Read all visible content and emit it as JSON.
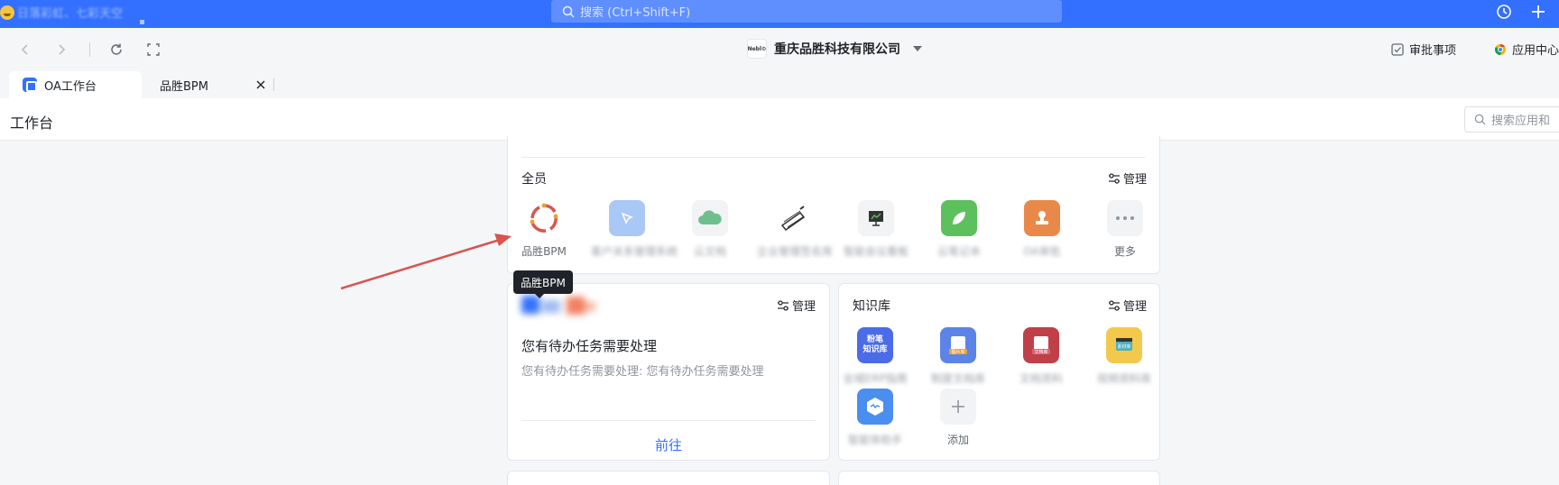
{
  "topbar": {
    "user_status": "日落彩虹、七彩天空",
    "search_placeholder": "搜索 (Ctrl+Shift+F)"
  },
  "navbar": {
    "company_name": "重庆品胜科技有限公司",
    "company_logo_text": "Nebl⚙",
    "approvals": "审批事项",
    "app_center": "应用中心"
  },
  "tabs": [
    {
      "label": "OA工作台"
    },
    {
      "label": "品胜BPM"
    }
  ],
  "header": {
    "title": "工作台",
    "search_placeholder": "搜索应用和"
  },
  "quanyuan": {
    "title": "全员",
    "manage": "管理",
    "apps": [
      {
        "label": "品胜BPM",
        "icon": "bpm-icon",
        "color": "#ffffff"
      },
      {
        "label": "客户关系管理系统",
        "icon": "blue-app-icon",
        "color": "#a9c8f5"
      },
      {
        "label": "云文档",
        "icon": "cloud-icon",
        "color": "#f2f3f5"
      },
      {
        "label": "企业管理签名库",
        "icon": "sketch-icon",
        "color": "#ffffff"
      },
      {
        "label": "智能会议看板",
        "icon": "presentation-icon",
        "color": "#f2f3f5"
      },
      {
        "label": "云笔记本",
        "icon": "leaf-icon",
        "color": "#5cc05c"
      },
      {
        "label": "OA审批",
        "icon": "stamp-icon",
        "color": "#e8894a"
      },
      {
        "label": "更多",
        "icon": "more-icon",
        "color": "#f2f3f5"
      }
    ]
  },
  "tooltip": "品胜BPM",
  "todo": {
    "manage": "管理",
    "title": "您有待办任务需要处理",
    "desc": "您有待办任务需要处理: 您有待办任务需要处理",
    "go": "前往"
  },
  "knowledge": {
    "title": "知识库",
    "manage": "管理",
    "apps": [
      {
        "label": "全域ERP指南",
        "icon": "knowledge-base-icon",
        "color": "#4b6be8",
        "text": "粉笔\n知识库"
      },
      {
        "label": "制度文档库",
        "icon": "doc-library-icon",
        "color": "#5b84e6",
        "text": "图片库"
      },
      {
        "label": "文档资料",
        "icon": "file-library-icon",
        "color": "#c0404a",
        "text": "文档库"
      },
      {
        "label": "视频资料库",
        "icon": "video-library-icon",
        "color": "#f2c94c",
        "text": "素材库"
      },
      {
        "label": "智能体助手",
        "icon": "robot-icon",
        "color": "#4a8ef0",
        "text": ""
      },
      {
        "label": "添加",
        "icon": "add-icon",
        "color": "#f2f3f5",
        "text": ""
      }
    ]
  }
}
